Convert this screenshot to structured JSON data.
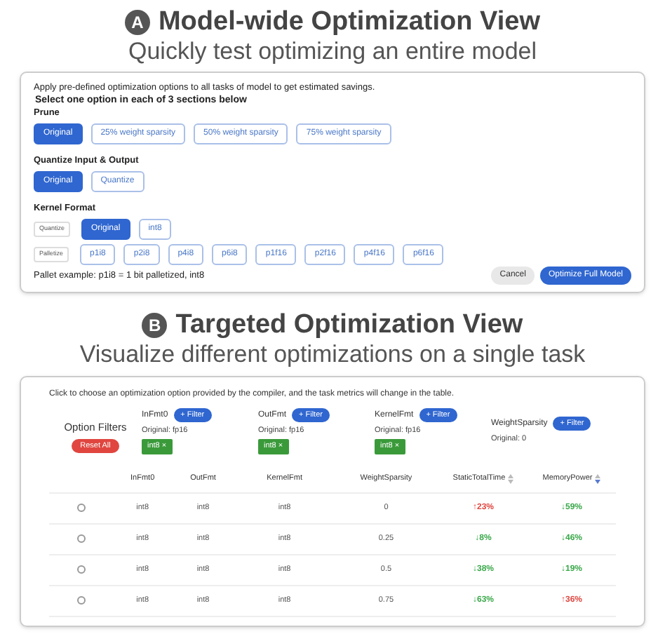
{
  "section_a": {
    "badge": "A",
    "title": "Model-wide Optimization View",
    "subtitle": "Quickly test optimizing an entire model",
    "intro": "Apply pre-defined optimization options to all tasks of model to get estimated savings.",
    "instruction": "Select one option in each of 3 sections below",
    "groups": [
      {
        "label": "Prune",
        "rows": [
          {
            "options": [
              {
                "label": "Original",
                "selected": true
              },
              {
                "label": "25% weight sparsity",
                "selected": false
              },
              {
                "label": "50% weight sparsity",
                "selected": false
              },
              {
                "label": "75% weight sparsity",
                "selected": false
              }
            ]
          }
        ]
      },
      {
        "label": "Quantize Input & Output",
        "rows": [
          {
            "options": [
              {
                "label": "Original",
                "selected": true
              },
              {
                "label": "Quantize",
                "selected": false
              }
            ]
          }
        ]
      },
      {
        "label": "Kernel Format",
        "rows": [
          {
            "tag": "Quantize",
            "options": [
              {
                "label": "Original",
                "selected": true
              },
              {
                "label": "int8",
                "selected": false
              }
            ]
          },
          {
            "tag": "Palletize",
            "options": [
              {
                "label": "p1i8",
                "selected": false
              },
              {
                "label": "p2i8",
                "selected": false
              },
              {
                "label": "p4i8",
                "selected": false
              },
              {
                "label": "p6i8",
                "selected": false
              },
              {
                "label": "p1f16",
                "selected": false
              },
              {
                "label": "p2f16",
                "selected": false
              },
              {
                "label": "p4f16",
                "selected": false
              },
              {
                "label": "p6f16",
                "selected": false
              }
            ]
          }
        ]
      }
    ],
    "note": "Pallet example: p1i8 = 1 bit palletized, int8",
    "cancel": "Cancel",
    "submit": "Optimize Full Model"
  },
  "section_b": {
    "badge": "B",
    "title": "Targeted Optimization View",
    "subtitle": "Visualize different optimizations on a single task",
    "intro": "Click to choose an optimization option provided by the compiler, and the task metrics will change in the table.",
    "filters_label": "Option Filters",
    "reset": "Reset All",
    "filters": [
      {
        "name": "InFmt0",
        "button": "+ Filter",
        "original": "Original: fp16",
        "chips": [
          "int8 ×"
        ]
      },
      {
        "name": "OutFmt",
        "button": "+ Filter",
        "original": "Original: fp16",
        "chips": [
          "int8 ×"
        ]
      },
      {
        "name": "KernelFmt",
        "button": "+ Filter",
        "original": "Original: fp16",
        "chips": [
          "int8 ×"
        ]
      },
      {
        "name": "WeightSparsity",
        "button": "+ Filter",
        "original": "Original: 0"
      }
    ],
    "table": {
      "columns": [
        {
          "label": "InFmt0",
          "sortable": false
        },
        {
          "label": "OutFmt",
          "sortable": false
        },
        {
          "label": "KernelFmt",
          "sortable": false
        },
        {
          "label": "WeightSparsity",
          "sortable": false
        },
        {
          "label": "StaticTotalTime",
          "sortable": true
        },
        {
          "label": "MemoryPower",
          "sortable": true
        }
      ],
      "rows": [
        {
          "selected": false,
          "cells": [
            "int8",
            "int8",
            "int8",
            "0"
          ],
          "metrics": [
            {
              "text": "↑23%",
              "color": "#e0463f"
            },
            {
              "text": "↓59%",
              "color": "#3aa84a"
            }
          ]
        },
        {
          "selected": false,
          "cells": [
            "int8",
            "int8",
            "int8",
            "0.25"
          ],
          "metrics": [
            {
              "text": "↓8%",
              "color": "#3aa84a"
            },
            {
              "text": "↓46%",
              "color": "#3aa84a"
            }
          ]
        },
        {
          "selected": false,
          "cells": [
            "int8",
            "int8",
            "int8",
            "0.5"
          ],
          "metrics": [
            {
              "text": "↓38%",
              "color": "#3aa84a"
            },
            {
              "text": "↓19%",
              "color": "#3aa84a"
            }
          ]
        },
        {
          "selected": false,
          "cells": [
            "int8",
            "int8",
            "int8",
            "0.75"
          ],
          "metrics": [
            {
              "text": "↓63%",
              "color": "#3aa84a"
            },
            {
              "text": "↑36%",
              "color": "#e0463f"
            }
          ]
        }
      ]
    }
  }
}
